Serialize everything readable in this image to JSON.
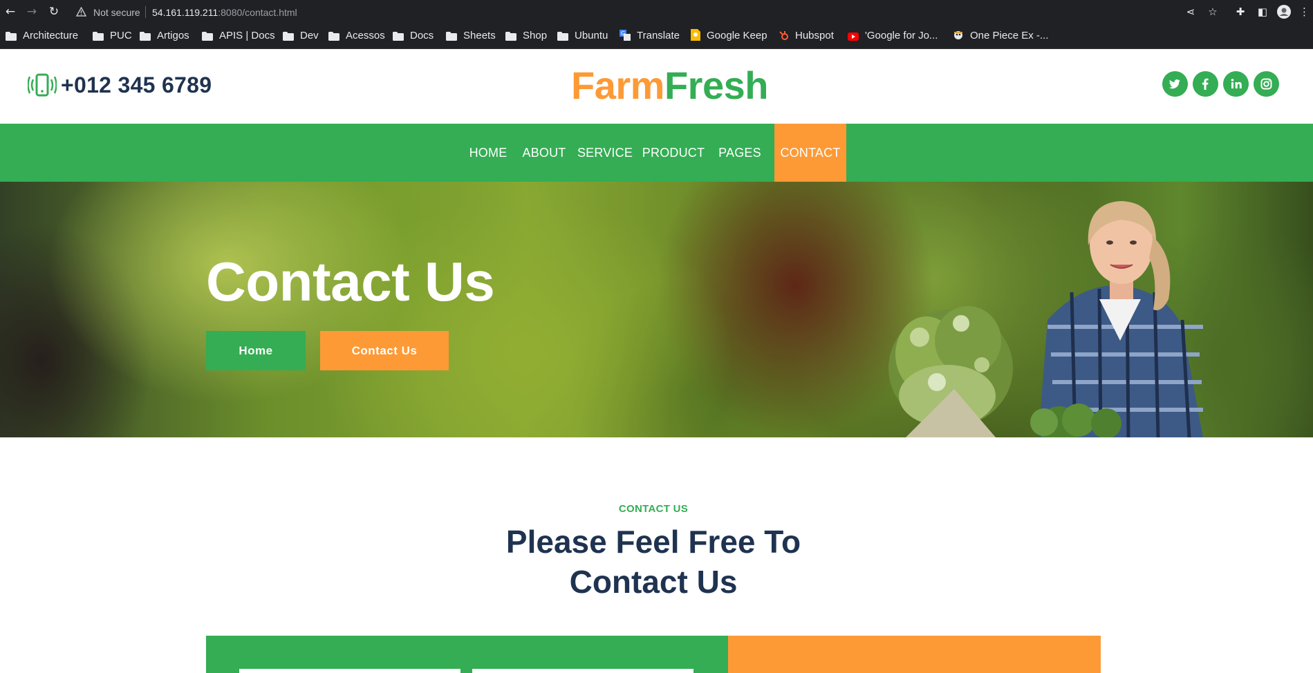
{
  "browser": {
    "security_label": "Not secure",
    "url_host": "54.161.119.211",
    "url_rest": ":8080/contact.html",
    "bookmarks": [
      {
        "label": "Architecture",
        "icon": "folder-icon"
      },
      {
        "label": "PUC",
        "icon": "folder-icon"
      },
      {
        "label": "Artigos",
        "icon": "folder-icon"
      },
      {
        "label": "APIS | Docs",
        "icon": "folder-icon"
      },
      {
        "label": "Dev",
        "icon": "folder-icon"
      },
      {
        "label": "Acessos",
        "icon": "folder-icon"
      },
      {
        "label": "Docs",
        "icon": "folder-icon"
      },
      {
        "label": "Sheets",
        "icon": "folder-icon"
      },
      {
        "label": "Shop",
        "icon": "folder-icon"
      },
      {
        "label": "Ubuntu",
        "icon": "folder-icon"
      },
      {
        "label": "Translate",
        "icon": "translate-icon"
      },
      {
        "label": "Google Keep",
        "icon": "keep-icon"
      },
      {
        "label": "Hubspot",
        "icon": "hubspot-icon"
      },
      {
        "label": "'Google for Jo...",
        "icon": "youtube-icon"
      },
      {
        "label": "One Piece Ex -...",
        "icon": "onepiece-icon"
      }
    ]
  },
  "header": {
    "phone": "+012 345 6789",
    "logo_part1": "Farm",
    "logo_part2": "Fresh",
    "socials": [
      {
        "label": "twitter",
        "glyph": "t"
      },
      {
        "label": "facebook",
        "glyph": "f"
      },
      {
        "label": "linkedin",
        "glyph": "in"
      },
      {
        "label": "instagram",
        "glyph": "◎"
      }
    ]
  },
  "nav": {
    "items": [
      "HOME",
      "ABOUT",
      "SERVICE",
      "PRODUCT",
      "PAGES",
      "CONTACT"
    ],
    "active": "CONTACT"
  },
  "hero": {
    "title": "Contact Us",
    "breadcrumb_home": "Home",
    "breadcrumb_current": "Contact Us"
  },
  "contact": {
    "tag": "CONTACT US",
    "title": "Please Feel Free To Contact Us"
  },
  "colors": {
    "brand_green": "#34ad54",
    "brand_orange": "#fd9a36",
    "heading_navy": "#1f3350"
  }
}
